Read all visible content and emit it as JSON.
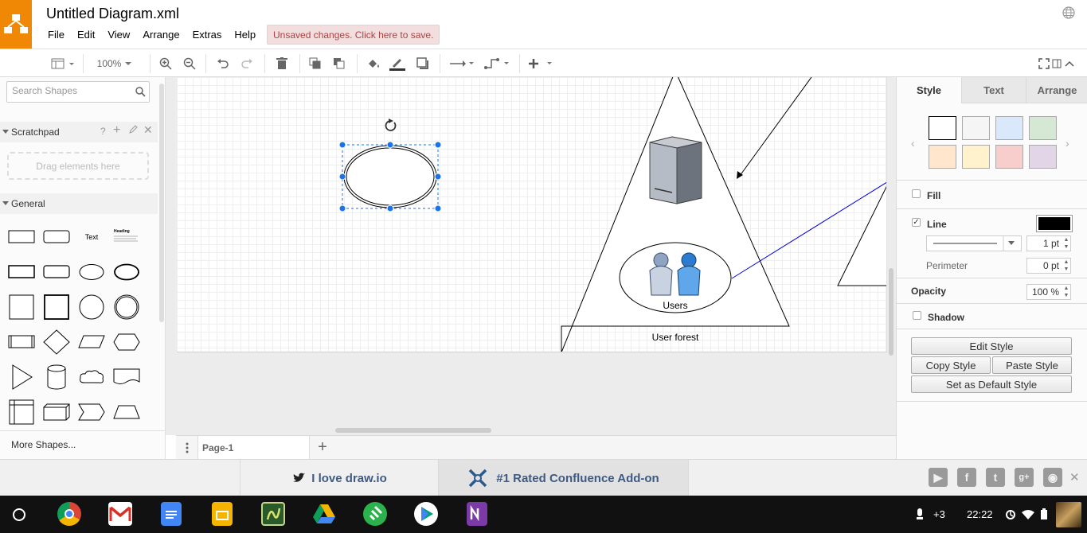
{
  "app": {
    "title": "Untitled Diagram.xml",
    "menu": [
      "File",
      "Edit",
      "View",
      "Arrange",
      "Extras",
      "Help"
    ],
    "unsaved_notice": "Unsaved changes. Click here to save."
  },
  "toolbar": {
    "zoom": "100%"
  },
  "sidebar": {
    "search_placeholder": "Search Shapes",
    "scratchpad_title": "Scratchpad",
    "scratchpad_help": "?",
    "drag_hint": "Drag elements here",
    "general_title": "General",
    "text_shape_label": "Text",
    "heading_shape_label": "Heading",
    "more_shapes": "More Shapes..."
  },
  "canvas": {
    "users_label": "Users",
    "forest_label": "User forest"
  },
  "pages": {
    "tab": "Page-1"
  },
  "format_panel": {
    "tabs": [
      "Style",
      "Text",
      "Arrange"
    ],
    "fill_label": "Fill",
    "line_label": "Line",
    "line_width": "1 pt",
    "perimeter_label": "Perimeter",
    "perimeter_value": "0 pt",
    "opacity_label": "Opacity",
    "opacity_value": "100 %",
    "shadow_label": "Shadow",
    "edit_style": "Edit Style",
    "copy_style": "Copy Style",
    "paste_style": "Paste Style",
    "default_style": "Set as Default Style",
    "swatches": [
      "#ffffff",
      "#f5f5f5",
      "#dae8fc",
      "#d5e8d4",
      "#ffe6cc",
      "#fff2cc",
      "#f8cecc",
      "#e1d5e7"
    ],
    "line_color": "#000000"
  },
  "footer": {
    "promo_twitter": "I love draw.io",
    "promo_confluence": "#1 Rated Confluence Add-on"
  },
  "taskbar": {
    "notification_count": "+3",
    "clock": "22:22"
  },
  "colors": {
    "accent_orange": "#f08705",
    "selection_blue": "#1a73e8",
    "link_blue": "#3f5a82"
  }
}
